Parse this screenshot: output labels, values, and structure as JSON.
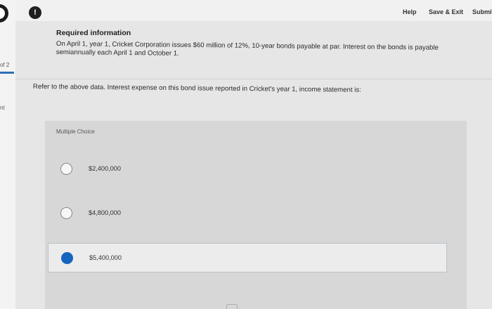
{
  "header": {
    "help": "Help",
    "save_exit": "Save & Exit",
    "submit": "Submit"
  },
  "rail": {
    "page_of": "of 2",
    "points": "nt"
  },
  "alert_icon": "!",
  "required_info": {
    "title": "Required information",
    "body": "On April 1, year 1, Cricket Corporation issues $60 million of 12%, 10-year bonds payable at par. Interest on the bonds is payable semiannually each April 1 and October 1."
  },
  "question": {
    "text": "Refer to the above data. Interest expense on this bond issue reported in Cricket's year 1, income statement is:",
    "type_label": "Multiple Choice",
    "options": [
      {
        "label": "$2,400,000",
        "selected": false
      },
      {
        "label": "$4,800,000",
        "selected": false
      },
      {
        "label": "$5,400,000",
        "selected": true
      }
    ]
  },
  "colors": {
    "selected_radio": "#1565c0",
    "accent_bar": "#2f6fb5"
  }
}
